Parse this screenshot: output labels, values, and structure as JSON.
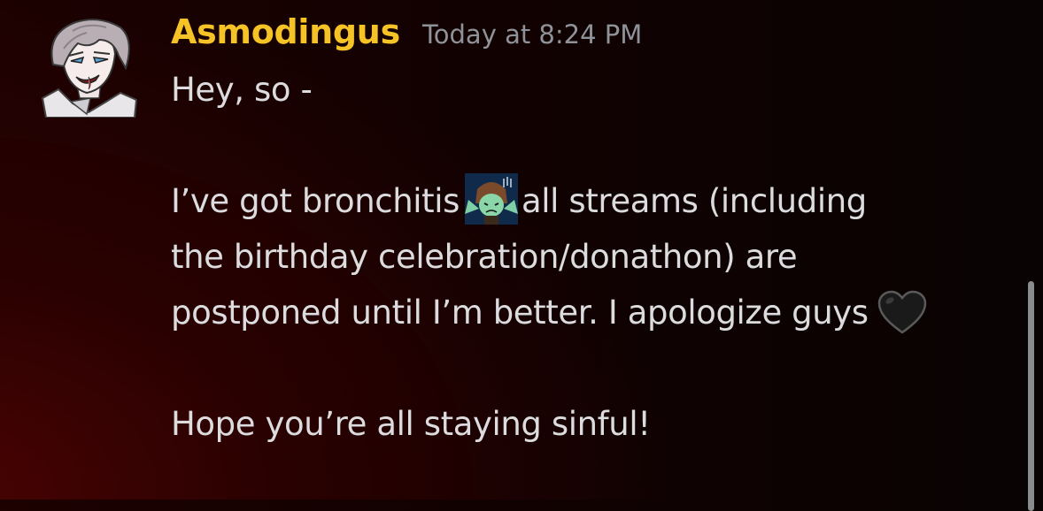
{
  "message": {
    "author": "Asmodingus",
    "timestamp": "Today at 8:24 PM",
    "lines": {
      "l1": "Hey, so -",
      "l3a": "I’ve got bronchitis",
      "l3b": "all streams (including",
      "l4": "the birthday celebration/donathon) are",
      "l5": "postponed until I’m better. I apologize guys",
      "l7": "Hope you’re all staying sinful!"
    },
    "emojis": {
      "custom": "sick-character-emoji",
      "heart": "black-heart-emoji"
    }
  },
  "colors": {
    "username": "#f6c327",
    "timestamp": "#8f9399",
    "text": "#dcdcde",
    "background": "#120101"
  }
}
